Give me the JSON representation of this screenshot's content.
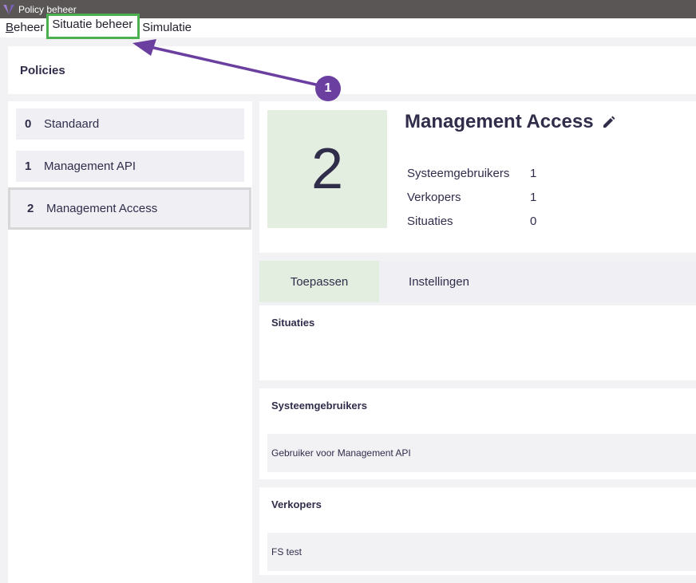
{
  "window": {
    "title": "Policy beheer"
  },
  "menu": {
    "items": [
      {
        "accel": "B",
        "rest": "eheer"
      },
      {
        "label": "Situatie beheer"
      },
      {
        "label": "Simulatie"
      }
    ]
  },
  "header": {
    "title": "Policies"
  },
  "sidebar": {
    "policies": [
      {
        "number": "0",
        "name": "Standaard"
      },
      {
        "number": "1",
        "name": "Management API"
      },
      {
        "number": "2",
        "name": "Management Access"
      }
    ]
  },
  "detail": {
    "big_number": "2",
    "title": "Management Access",
    "stats": [
      {
        "label": "Systeemgebruikers",
        "value": "1"
      },
      {
        "label": "Verkopers",
        "value": "1"
      },
      {
        "label": "Situaties",
        "value": "0"
      }
    ]
  },
  "tabs": [
    {
      "label": "Toepassen"
    },
    {
      "label": "Instellingen"
    }
  ],
  "sections": {
    "situaties": {
      "title": "Situaties"
    },
    "systeemgebruikers": {
      "title": "Systeemgebruikers",
      "rows": [
        "Gebruiker voor Management API"
      ]
    },
    "verkopers": {
      "title": "Verkopers",
      "rows": [
        "FS test"
      ]
    }
  },
  "annotation": {
    "badge": "1"
  },
  "colors": {
    "accent_purple": "#6a3fa0",
    "highlight_green": "#4caf50",
    "active_tab": "#e4eee0"
  }
}
